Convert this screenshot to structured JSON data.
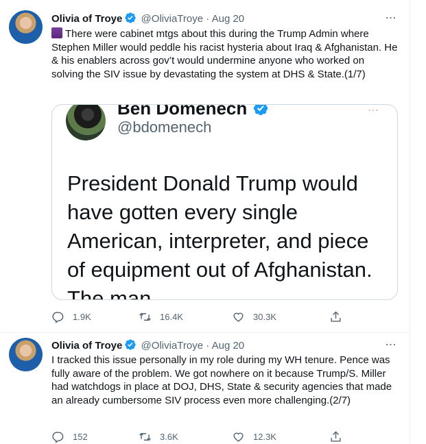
{
  "tweets": [
    {
      "author": "Olivia of Troye",
      "handle": "@OliviaTroye",
      "separator": "·",
      "date": "Aug 20",
      "text": "There were cabinet mtgs about this during the Trump Admin where Stephen Miller would peddle his racist hysteria about Iraq & Afghanistan. He & his enablers across gov’t would undermine anyone who worked on solving the SIV issue by devastating the system at DHS & State.(1/7)",
      "replies": "1.9K",
      "retweets": "16.4K",
      "likes": "30.3K"
    },
    {
      "author": "Olivia of Troye",
      "handle": "@OliviaTroye",
      "separator": "·",
      "date": "Aug 20",
      "text": "I tracked this issue personally in my role during my WH tenure. Pence was fully aware of the problem. We got nowhere on it because Trump/S. Miller had watchdogs in place at DOJ, DHS, State & security agencies that made an already cumbersome SIV process even more challenging.(2/7)",
      "replies": "152",
      "retweets": "3.6K",
      "likes": "12.3K"
    }
  ],
  "quoted": {
    "author": "Ben Domenech",
    "handle": "@bdomenech",
    "text": "President Donald Trump would have gotten every single American, interpreter, and piece of equipment out of Afghanistan. The man"
  },
  "colors": {
    "verified": "#1d9bf0",
    "secondary": "#536471",
    "border": "#cfd9de"
  },
  "icons": {
    "more": "⋯"
  }
}
